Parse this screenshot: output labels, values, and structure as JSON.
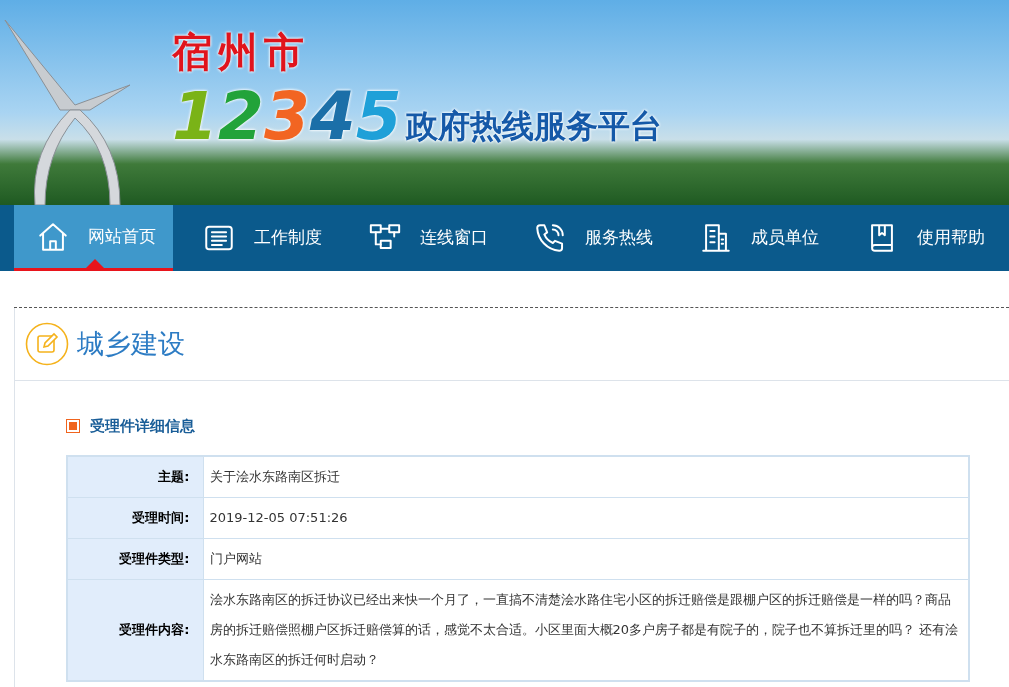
{
  "banner": {
    "city": "宿州市",
    "digits": [
      {
        "text": "1",
        "color": "#7ab317"
      },
      {
        "text": "2",
        "color": "#22a33a"
      },
      {
        "text": "3",
        "color": "#f26522"
      },
      {
        "text": "4",
        "color": "#1b6fa8"
      },
      {
        "text": "5",
        "color": "#1fa0d8"
      }
    ],
    "title": "政府热线服务平台"
  },
  "nav": [
    {
      "label": "网站首页",
      "kind": "home",
      "selected": true
    },
    {
      "label": "工作制度",
      "kind": "document",
      "selected": false
    },
    {
      "label": "连线窗口",
      "kind": "network",
      "selected": false
    },
    {
      "label": "服务热线",
      "kind": "phone",
      "selected": false
    },
    {
      "label": "成员单位",
      "kind": "building",
      "selected": false
    },
    {
      "label": "使用帮助",
      "kind": "book",
      "selected": false
    }
  ],
  "section": {
    "title": "城乡建设"
  },
  "detail": {
    "heading": "受理件详细信息",
    "rows": [
      {
        "label": "主题:",
        "value": "关于浍水东路南区拆迁"
      },
      {
        "label": "受理时间:",
        "value": "2019-12-05 07:51:26"
      },
      {
        "label": "受理件类型:",
        "value": "门户网站"
      },
      {
        "label": "受理件内容:",
        "value": "浍水东路南区的拆迁协议已经出来快一个月了，一直搞不清楚浍水路住宅小区的拆迁赔偿是跟棚户区的拆迁赔偿是一样的吗？商品房的拆迁赔偿照棚户区拆迁赔偿算的话，感觉不太合适。小区里面大概20多户房子都是有院子的，院子也不算拆迁里的吗？ 还有浍水东路南区的拆迁何时启动？"
      }
    ]
  }
}
